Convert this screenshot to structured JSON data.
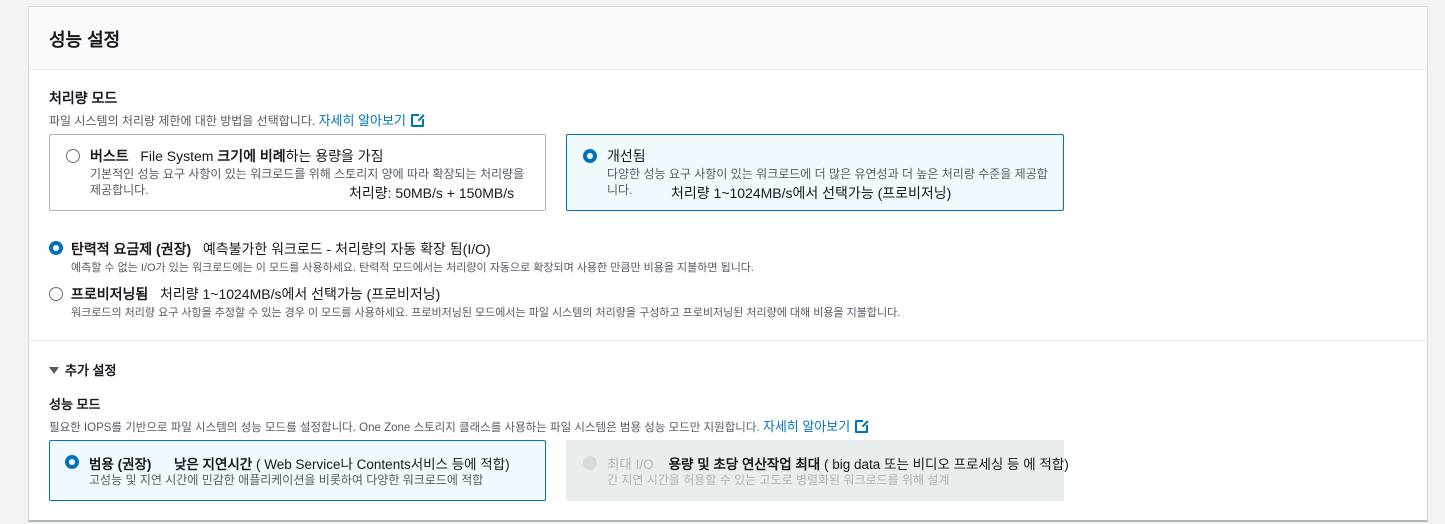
{
  "panel": {
    "title": "성능 설정"
  },
  "throughput": {
    "label": "처리량 모드",
    "description": "파일 시스템의 처리량 제한에 대한 방법을 선택합니다.",
    "learn_more": "자세히 알아보기",
    "tiles": [
      {
        "name": "버스트",
        "subtitle_pre": "File System ",
        "subtitle_bold": "크기에 비례",
        "subtitle_post": "하는 용량을 가짐",
        "description": "기본적인 성능 요구 사항이 있는 워크로드를 위해 스토리지 양에 따라 확장되는 처리량을 제공합니다.",
        "throughput": "처리량: 50MB/s + 150MB/s",
        "selected": false
      },
      {
        "name": "개선됨",
        "description": "다양한 성능 요구 사항이 있는 워크로드에 더 많은 유연성과 더 높은 처리량 수준을 제공합니다.",
        "throughput": "처리량  1~1024MB/s에서 선택가능 (프로비저닝)",
        "selected": true
      }
    ],
    "options": [
      {
        "name": "탄력적 요금제 (권장)",
        "detail": "예측불가한 워크로드 - 처리량의 자동 확장 됨(I/O)",
        "description": "예측할 수 없는 I/O가 있는 워크로드에는 이 모드를 사용하세요. 탄력적 모드에서는 처리량이 자동으로 확장되며 사용한 만큼만 비용을 지불하면 됩니다.",
        "selected": true
      },
      {
        "name": "프로비저닝됨",
        "detail": "처리량  1~1024MB/s에서 선택가능 (프로비저닝)",
        "description": "워크로드의 처리량 요구 사항을 추정할 수 있는 경우 이 모드를 사용하세요. 프로비저닝된 모드에서는 파일 시스템의 처리량을 구성하고 프로비저닝된 처리량에 대해 비용을 지불합니다.",
        "selected": false
      }
    ]
  },
  "additional": {
    "toggle_label": "추가 설정",
    "performance_label": "성능 모드",
    "performance_description": "필요한 IOPS를 기반으로 파일 시스템의 성능 모드를 설정합니다. One Zone 스토리지 클래스를 사용하는 파일 시스템은 범용 성능 모드만 지원합니다.",
    "learn_more": "자세히 알아보기",
    "tiles": [
      {
        "name": "범용 (권장)",
        "detail_bold": "낮은 지연시간",
        "detail_post": " ( Web Service나 Contents서비스 등에 적합)",
        "description": "고성능 및 지연 시간에 민감한 애플리케이션을 비롯하여 다양한 워크로드에 적합",
        "selected": true
      },
      {
        "name": "최대 I/O",
        "detail_bold": "용량 및 초당 연산작업 최대",
        "detail_post": " ( big data 또는 비디오 프로세싱 등 에 적합)",
        "description": "긴 지연 시간을 허용할 수 있는 고도로 병렬화된 워크로드를 위해 설계",
        "disabled": true
      }
    ]
  },
  "colors": {
    "accent": "#0073bb",
    "selected_bg": "#f1faff",
    "disabled_bg": "#eaeded"
  }
}
